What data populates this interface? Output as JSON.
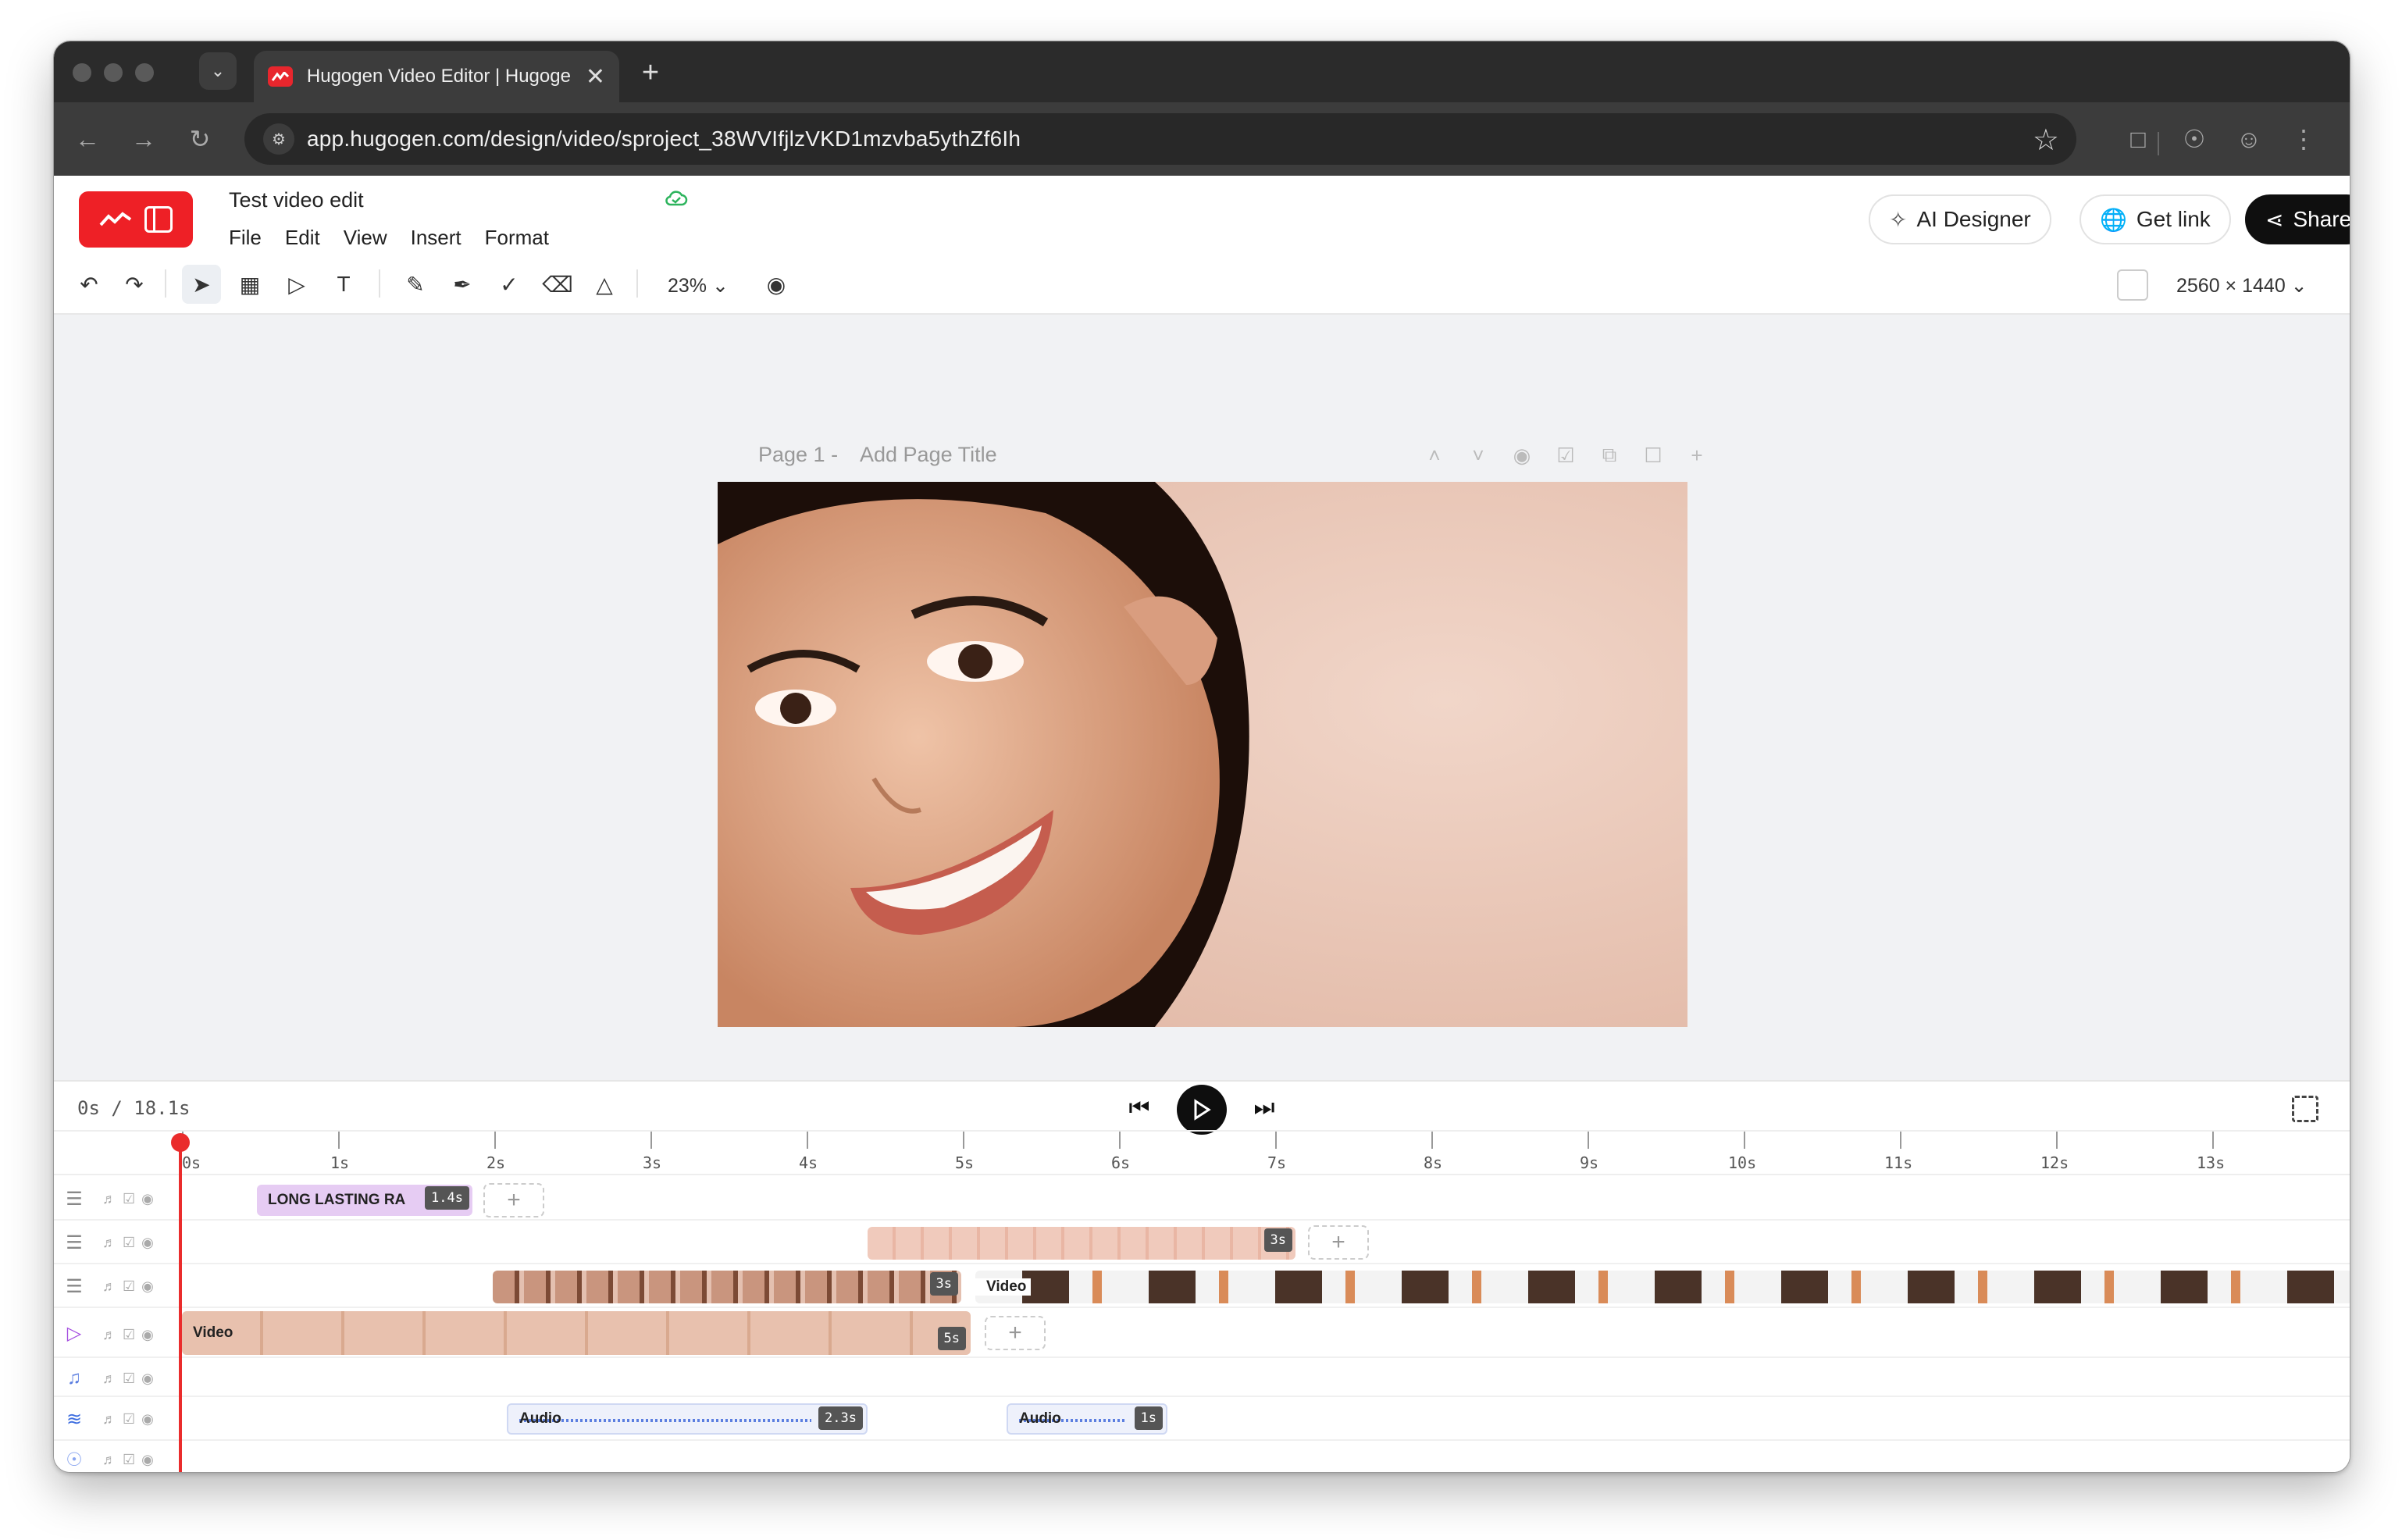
{
  "browser": {
    "tab_title": "Hugogen Video Editor | Hugogen",
    "url": "app.hugogen.com/design/video/sproject_38WVIfjlzVKD1mzvba5ythZf6Ih"
  },
  "app": {
    "project_title": "Test video edit",
    "menu": [
      "File",
      "Edit",
      "View",
      "Insert",
      "Format"
    ],
    "buttons": {
      "ai_designer": "AI Designer",
      "get_link": "Get link",
      "share": "Share"
    },
    "zoom": "23%",
    "canvas_size": "2560 × 1440",
    "brand_color": "#ee2026"
  },
  "page": {
    "label": "Page 1 -",
    "title_placeholder": "Add Page Title"
  },
  "timeline": {
    "timecode": "0s / 18.1s",
    "ruler": [
      "0s",
      "1s",
      "2s",
      "3s",
      "4s",
      "5s",
      "6s",
      "7s",
      "8s",
      "9s",
      "10s",
      "11s",
      "12s",
      "13s"
    ],
    "tracks": [
      {
        "type": "layer",
        "clips": [
          {
            "label": "LONG LASTING RA",
            "duration": "1.4s"
          }
        ]
      },
      {
        "type": "layer",
        "clips": [
          {
            "label": "",
            "duration": "3s"
          }
        ]
      },
      {
        "type": "layer",
        "clips": [
          {
            "label": "",
            "duration": "3s"
          },
          {
            "label": "Video",
            "duration": ""
          }
        ]
      },
      {
        "type": "video",
        "clips": [
          {
            "label": "Video",
            "duration": "5s"
          }
        ]
      },
      {
        "type": "music",
        "clips": []
      },
      {
        "type": "audio",
        "clips": [
          {
            "label": "Audio",
            "duration": "2.3s"
          },
          {
            "label": "Audio",
            "duration": "1s"
          }
        ]
      },
      {
        "type": "voice",
        "clips": []
      }
    ],
    "playhead_color": "#ea2c2c"
  }
}
